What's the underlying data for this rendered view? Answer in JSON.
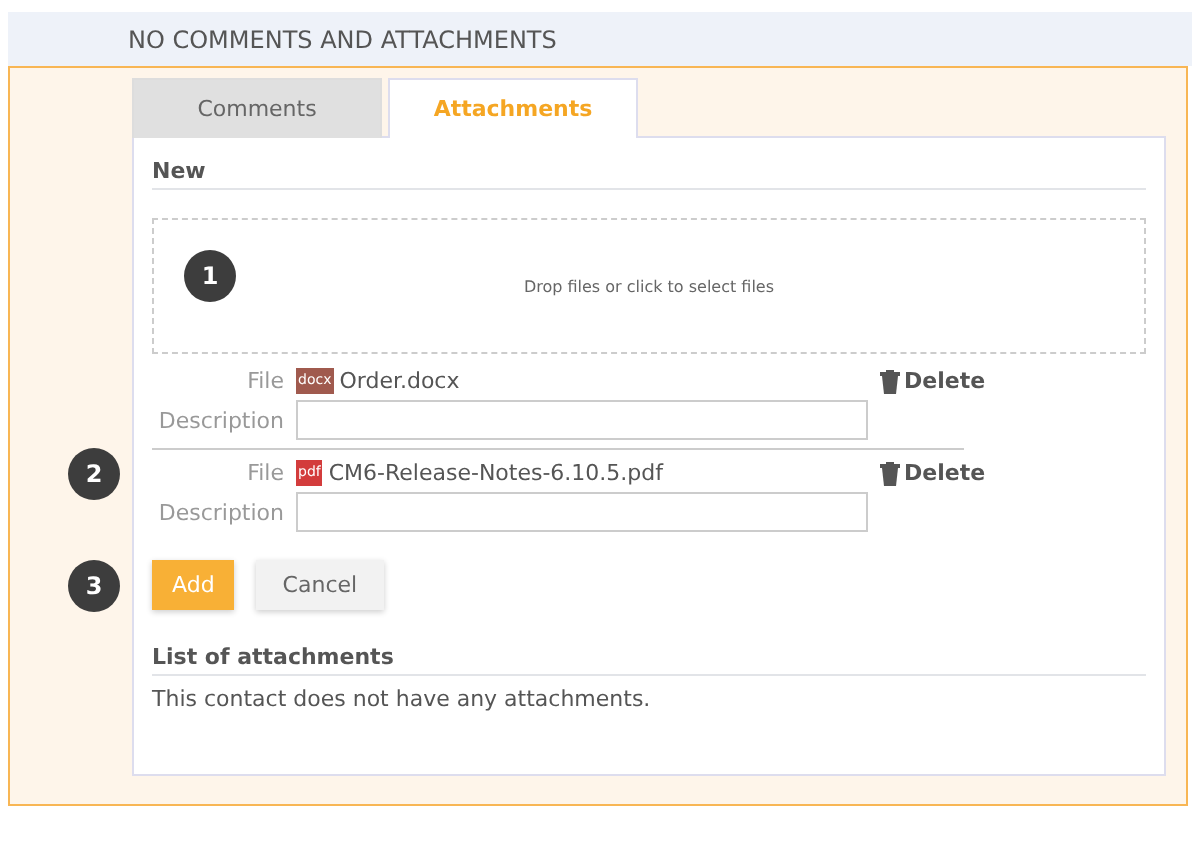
{
  "header": {
    "title": "NO COMMENTS AND ATTACHMENTS"
  },
  "tabs": [
    {
      "label": "Comments",
      "selected": false
    },
    {
      "label": "Attachments",
      "selected": true
    }
  ],
  "new_section": {
    "title": "New",
    "dropzone": {
      "text": "Drop files or click to select files",
      "callout": "1"
    }
  },
  "files_callout": "2",
  "files": [
    {
      "file_label": "File",
      "kind": "docx",
      "type_label": "docx",
      "name": "Order.docx",
      "delete": "Delete",
      "description_label": "Description"
    },
    {
      "file_label": "File",
      "kind": "pdf",
      "type_label": "pdf",
      "name": "CM6-Release-Notes-6.10.5.pdf",
      "delete": "Delete",
      "description_label": "Description"
    }
  ],
  "buttons_callout": "3",
  "buttons": [
    {
      "label": "Add",
      "kind": "primary"
    },
    {
      "label": "Cancel",
      "kind": "secondary"
    }
  ],
  "list_section": {
    "title": "List of attachments",
    "empty_text": "This contact does not have any attachments."
  }
}
